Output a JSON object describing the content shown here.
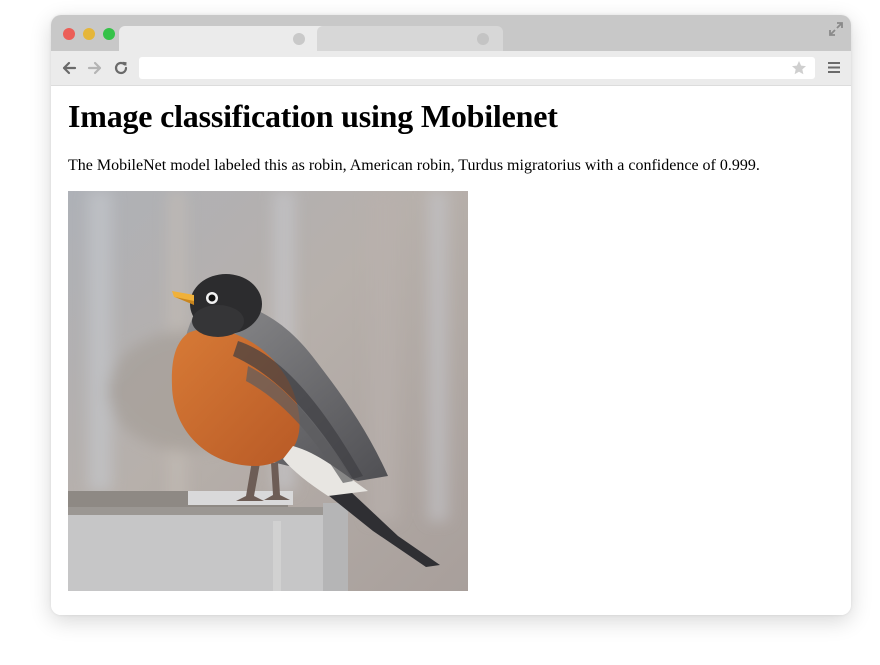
{
  "browser": {
    "tabs": [
      {
        "label": "",
        "active": true
      },
      {
        "label": "",
        "active": false
      }
    ],
    "address": {
      "value": ""
    },
    "icons": [
      "back-arrow-icon",
      "forward-arrow-icon",
      "reload-icon",
      "bookmark-star-icon",
      "menu-icon",
      "maximize-icon"
    ]
  },
  "page": {
    "title": "Image classification using Mobilenet",
    "result_text": "The MobileNet model labeled this as robin, American robin, Turdus migratorius with a confidence of 0.999."
  },
  "colors": {
    "close": "#ec5e57",
    "minimize": "#e5b63a",
    "zoom": "#35c248",
    "robin_breast": "#c9692e"
  }
}
